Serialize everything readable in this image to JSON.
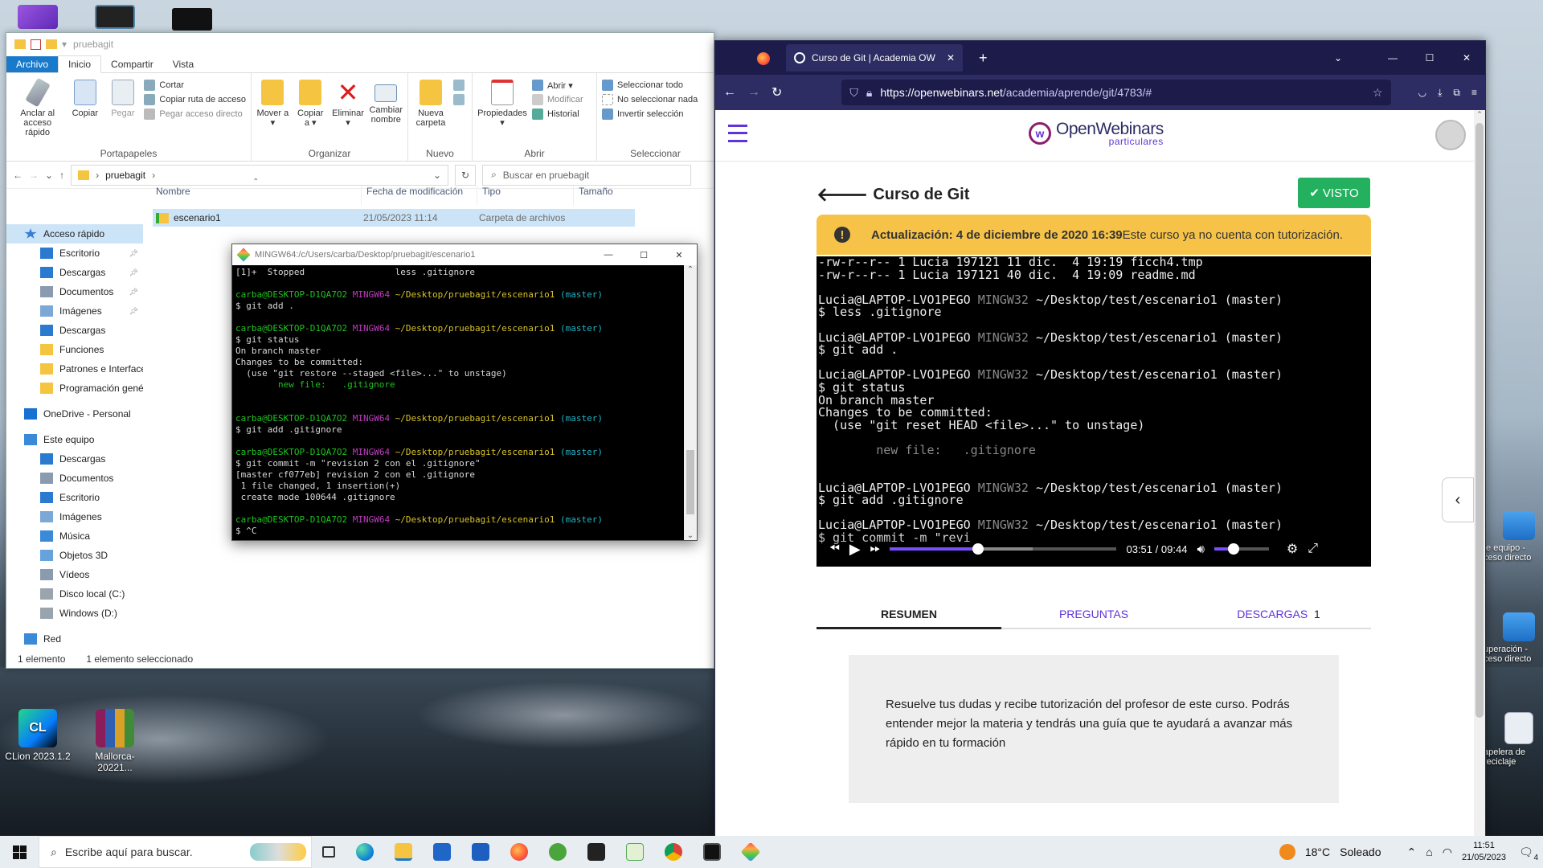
{
  "desktop": {
    "icons": [
      {
        "label": "CLion 2023.1.2",
        "icon": "clion-icon"
      },
      {
        "label": "Mallorca-20221...",
        "icon": "winrar-archive-icon"
      }
    ],
    "right_icons": [
      {
        "label": "te equipo - ceso directo",
        "icon": "computer-shortcut-icon"
      },
      {
        "label": "uperación - ceso directo",
        "icon": "recovery-shortcut-icon"
      },
      {
        "label": "apelera de reciclaje",
        "icon": "recycle-bin-icon"
      }
    ]
  },
  "explorer": {
    "title": "pruebagit",
    "tabs": [
      "Archivo",
      "Inicio",
      "Compartir",
      "Vista"
    ],
    "ribbon": {
      "portapapeles": {
        "label": "Portapapeles",
        "anclar": "Anclar al\nacceso rápido",
        "copiar": "Copiar",
        "pegar": "Pegar",
        "cortar": "Cortar",
        "copiar_ruta": "Copiar ruta de acceso",
        "pegar_acceso": "Pegar acceso directo"
      },
      "organizar": {
        "label": "Organizar",
        "mover": "Mover a ▾",
        "copiar_a": "Copiar a ▾",
        "eliminar": "Eliminar ▾",
        "cambiar": "Cambiar nombre"
      },
      "nuevo": {
        "label": "Nuevo",
        "nueva_carpeta": "Nueva carpeta"
      },
      "abrir": {
        "label": "Abrir",
        "propiedades": "Propiedades ▾",
        "abrir": "Abrir ▾",
        "modificar": "Modificar",
        "historial": "Historial"
      },
      "seleccionar": {
        "label": "Seleccionar",
        "todo": "Seleccionar todo",
        "nada": "No seleccionar nada",
        "invertir": "Invertir selección"
      }
    },
    "breadcrumb": "pruebagit",
    "search_placeholder": "Buscar en pruebagit",
    "columns": [
      "Nombre",
      "Fecha de modificación",
      "Tipo",
      "Tamaño"
    ],
    "rows": [
      {
        "name": "escenario1",
        "date": "21/05/2023 11:14",
        "type": "Carpeta de archivos",
        "size": ""
      }
    ],
    "nav": [
      {
        "label": "Acceso rápido",
        "icon": "star-icon",
        "pinned": false
      },
      {
        "label": "Escritorio",
        "icon": "desktop-folder-icon",
        "pinned": true
      },
      {
        "label": "Descargas",
        "icon": "download-folder-icon",
        "pinned": true
      },
      {
        "label": "Documentos",
        "icon": "documents-folder-icon",
        "pinned": true
      },
      {
        "label": "Imágenes",
        "icon": "pictures-folder-icon",
        "pinned": true
      },
      {
        "label": "Descargas",
        "icon": "download-folder-icon",
        "pinned": false
      },
      {
        "label": "Funciones",
        "icon": "folder-icon",
        "pinned": false
      },
      {
        "label": "Patrones e Interfaces",
        "icon": "folder-icon",
        "pinned": false
      },
      {
        "label": "Programación genéri",
        "icon": "folder-icon",
        "pinned": false
      },
      {
        "label": "OneDrive - Personal",
        "icon": "onedrive-icon",
        "pinned": false
      },
      {
        "label": "Este equipo",
        "icon": "computer-icon",
        "pinned": false
      },
      {
        "label": "Descargas",
        "icon": "download-folder-icon",
        "pinned": false
      },
      {
        "label": "Documentos",
        "icon": "documents-folder-icon",
        "pinned": false
      },
      {
        "label": "Escritorio",
        "icon": "desktop-folder-icon",
        "pinned": false
      },
      {
        "label": "Imágenes",
        "icon": "pictures-folder-icon",
        "pinned": false
      },
      {
        "label": "Música",
        "icon": "music-folder-icon",
        "pinned": false
      },
      {
        "label": "Objetos 3D",
        "icon": "3d-objects-icon",
        "pinned": false
      },
      {
        "label": "Vídeos",
        "icon": "videos-folder-icon",
        "pinned": false
      },
      {
        "label": "Disco local (C:)",
        "icon": "drive-icon",
        "pinned": false
      },
      {
        "label": "Windows (D:)",
        "icon": "drive-icon",
        "pinned": false
      },
      {
        "label": "Red",
        "icon": "network-icon",
        "pinned": false
      }
    ],
    "status_count": "1 elemento",
    "status_selected": "1 elemento seleccionado"
  },
  "mingw": {
    "title": "MINGW64:/c/Users/carba/Desktop/pruebagit/escenario1",
    "lines": [
      {
        "t": "plain",
        "text": "[1]+  Stopped                 less .gitignore"
      },
      {
        "t": "blank"
      },
      {
        "t": "prompt"
      },
      {
        "t": "plain",
        "text": "$ git add ."
      },
      {
        "t": "blank"
      },
      {
        "t": "prompt"
      },
      {
        "t": "plain",
        "text": "$ git status"
      },
      {
        "t": "plain",
        "text": "On branch master"
      },
      {
        "t": "plain",
        "text": "Changes to be committed:"
      },
      {
        "t": "plain",
        "text": "  (use \"git restore --staged <file>...\" to unstage)"
      },
      {
        "t": "green",
        "text": "        new file:   .gitignore"
      },
      {
        "t": "blank"
      },
      {
        "t": "blank"
      },
      {
        "t": "prompt"
      },
      {
        "t": "plain",
        "text": "$ git add .gitignore"
      },
      {
        "t": "blank"
      },
      {
        "t": "prompt"
      },
      {
        "t": "plain",
        "text": "$ git commit -m \"revision 2 con el .gitignore\""
      },
      {
        "t": "plain",
        "text": "[master cf077eb] revision 2 con el .gitignore"
      },
      {
        "t": "plain",
        "text": " 1 file changed, 1 insertion(+)"
      },
      {
        "t": "plain",
        "text": " create mode 100644 .gitignore"
      },
      {
        "t": "blank"
      },
      {
        "t": "prompt"
      },
      {
        "t": "plain",
        "text": "$ ^C"
      }
    ],
    "prompt_user": "carba@DESKTOP-D1QA7O2",
    "prompt_sys": "MINGW64",
    "prompt_path": "~/Desktop/pruebagit/escenario1",
    "prompt_branch": "(master)"
  },
  "firefox": {
    "tab_title": "Curso de Git | Academia OW",
    "url_host": "https://openwebinars.net",
    "url_path": "/academia/aprende/git/4783/#",
    "brand": "OpenWebinars",
    "brand_sub": "particulares",
    "course_title": "Curso de Git",
    "visto_label": "VISTO",
    "alert_bold": "Actualización: 4 de diciembre de 2020 16:39",
    "alert_text": " Este curso ya no cuenta con tutorización.",
    "video_lines": [
      {
        "t": "plain",
        "text": "-rw-r--r-- 1 Lucia 197121 11 dic.  4 19:19 ficch4.tmp"
      },
      {
        "t": "plain",
        "text": "-rw-r--r-- 1 Lucia 197121 40 dic.  4 19:09 readme.md"
      },
      {
        "t": "blank"
      },
      {
        "t": "prompt"
      },
      {
        "t": "plain",
        "text": "$ less .gitignore"
      },
      {
        "t": "blank"
      },
      {
        "t": "prompt"
      },
      {
        "t": "plain",
        "text": "$ git add ."
      },
      {
        "t": "blank"
      },
      {
        "t": "prompt"
      },
      {
        "t": "plain",
        "text": "$ git status"
      },
      {
        "t": "plain",
        "text": "On branch master"
      },
      {
        "t": "plain",
        "text": "Changes to be committed:"
      },
      {
        "t": "plain",
        "text": "  (use \"git reset HEAD <file>...\" to unstage)"
      },
      {
        "t": "blank"
      },
      {
        "t": "dim",
        "text": "        new file:   .gitignore"
      },
      {
        "t": "blank"
      },
      {
        "t": "blank"
      },
      {
        "t": "prompt"
      },
      {
        "t": "plain",
        "text": "$ git add .gitignore"
      },
      {
        "t": "blank"
      },
      {
        "t": "prompt"
      },
      {
        "t": "plain",
        "text": "$ git commit -m \"revi"
      }
    ],
    "video_prompt_user": "Lucia@LAPTOP-LVO1PEGO",
    "video_prompt_sys": "MINGW32",
    "video_prompt_path": "~/Desktop/test/escenario1 (master)",
    "time_current": "03:51",
    "time_sep": "/",
    "time_total": "09:44",
    "progress": 0.39,
    "buffered": 0.63,
    "volume": 0.35,
    "tabs": [
      {
        "label": "RESUMEN",
        "count": ""
      },
      {
        "label": "PREGUNTAS",
        "count": ""
      },
      {
        "label": "DESCARGAS",
        "count": "1"
      }
    ],
    "info_text": "Resuelve tus dudas y recibe tutorización del profesor de este curso. Podrás entender mejor la materia y tendrás una guía que te ayudará a avanzar más rápido en tu formación"
  },
  "taskbar": {
    "search_placeholder": "Escribe aquí para buscar.",
    "weather_temp": "18°C",
    "weather_text": "Soleado",
    "time": "11:51",
    "date": "21/05/2023",
    "notifications": "4"
  },
  "colors": {
    "ribbon_file": "#1979ca",
    "ff_dark": "#1c1b4a",
    "ow_purple": "#5f34d8",
    "visto_green": "#24b15f",
    "alert_yellow": "#f6c348"
  }
}
